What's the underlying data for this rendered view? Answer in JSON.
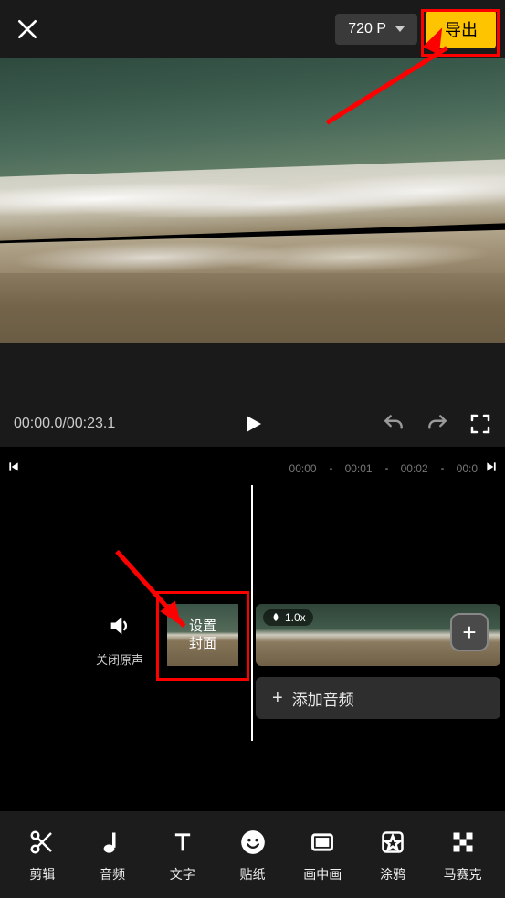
{
  "header": {
    "resolution": "720 P",
    "export_label": "导出"
  },
  "controls": {
    "timecode": "00:00.0/00:23.1"
  },
  "timeline": {
    "marks": [
      "00:00",
      "00:01",
      "00:02",
      "00:0"
    ],
    "mute_label": "关闭原声",
    "cover_label_l1": "设置",
    "cover_label_l2": "封面",
    "speed": "1.0x",
    "add_audio_label": "添加音频"
  },
  "toolbar": [
    {
      "name": "edit",
      "label": "剪辑"
    },
    {
      "name": "audio",
      "label": "音频"
    },
    {
      "name": "text",
      "label": "文字"
    },
    {
      "name": "sticker",
      "label": "贴纸"
    },
    {
      "name": "pip",
      "label": "画中画"
    },
    {
      "name": "doodle",
      "label": "涂鸦"
    },
    {
      "name": "mosaic",
      "label": "马赛克"
    }
  ]
}
